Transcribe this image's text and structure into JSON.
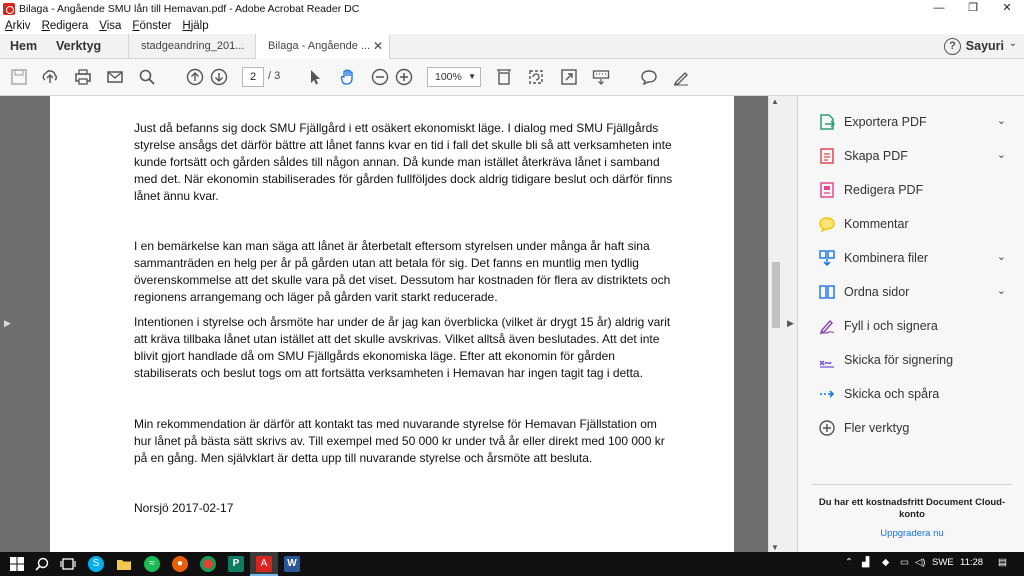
{
  "window": {
    "title": "Bilaga - Angående SMU lån till Hemavan.pdf - Adobe Acrobat Reader DC",
    "minimize": "—",
    "maximize": "❐",
    "close": "✕"
  },
  "menu": [
    {
      "accel": "A",
      "rest": "rkiv"
    },
    {
      "accel": "R",
      "rest": "edigera"
    },
    {
      "accel": "V",
      "rest": "isa"
    },
    {
      "accel": "F",
      "rest": "önster"
    },
    {
      "accel": "H",
      "rest": "jälp"
    }
  ],
  "tabs": {
    "home": "Hem",
    "tools": "Verktyg",
    "doc1": "stadgeandring_201...",
    "doc2": "Bilaga - Angående ...",
    "close": "✕"
  },
  "account": {
    "help": "?",
    "user": "Sayuri",
    "chevron": "⌄"
  },
  "toolbar": {
    "page_current": "2",
    "page_total": "/ 3",
    "zoom": "100%",
    "zoom_caret": "▼",
    "icons": [
      "save-icon",
      "upload-icon",
      "print-icon",
      "email-icon",
      "search-icon",
      "page-up-icon",
      "page-down-icon",
      "select-arrow-icon",
      "hand-icon",
      "zoom-out-icon",
      "zoom-in-icon",
      "fit-width-icon",
      "rotate-icon",
      "full-screen-icon",
      "keyboard-icon",
      "comment-icon",
      "sign-icon"
    ]
  },
  "document": {
    "paragraphs": [
      "Just då befanns sig dock SMU Fjällgård i ett osäkert ekonomiskt läge. I dialog med SMU Fjällgårds styrelse ansågs det därför bättre att lånet fanns kvar en tid i fall det skulle bli så att verksamheten inte kunde fortsätt och gården såldes till någon annan. Då kunde man istället återkräva lånet i samband med det. När ekonomin stabiliserades för gården fullföljdes dock aldrig tidigare beslut och därför finns lånet ännu kvar.",
      "I en bemärkelse kan man säga att lånet är återbetalt eftersom styrelsen under många år haft sina sammanträden en helg per år på gården utan att betala för sig. Det fanns en muntlig men tydlig överenskommelse att det skulle vara på det viset. Dessutom har kostnaden för flera av distriktets och regionens arrangemang och läger på gården varit starkt reducerade.",
      "Intentionen i styrelse och årsmöte har under de år jag kan överblicka (vilket är drygt 15 år) aldrig varit att kräva tillbaka lånet utan istället att det skulle avskrivas. Vilket alltså även beslutades. Att det inte blivit gjort handlade då om SMU Fjällgårds ekonomiska läge. Efter att ekonomin för gården stabiliserats och beslut togs om att fortsätta verksamheten i Hemavan har ingen tagit tag i detta.",
      "Min rekommendation är därför att kontakt tas med nuvarande styrelse för Hemavan Fjällstation om hur lånet på bästa sätt skrivs av. Till exempel med 50 000 kr under två år eller direkt med 100 000 kr på en gång. Men självklart är detta upp till nuvarande styrelse och årsmöte att besluta.",
      "Norsjö 2017-02-17"
    ]
  },
  "tools": [
    {
      "label": "Exportera PDF",
      "icon": "export-pdf-icon",
      "color": "#2d9d78",
      "chevron": true
    },
    {
      "label": "Skapa PDF",
      "icon": "create-pdf-icon",
      "color": "#e34850",
      "chevron": true
    },
    {
      "label": "Redigera PDF",
      "icon": "edit-pdf-icon",
      "color": "#e44a8a",
      "chevron": false
    },
    {
      "label": "Kommentar",
      "icon": "comment-icon",
      "color": "#f5c400",
      "chevron": false
    },
    {
      "label": "Kombinera filer",
      "icon": "combine-files-icon",
      "color": "#1473e6",
      "chevron": true
    },
    {
      "label": "Ordna sidor",
      "icon": "organize-pages-icon",
      "color": "#1473e6",
      "chevron": true
    },
    {
      "label": "Fyll i och signera",
      "icon": "fill-sign-icon",
      "color": "#8e44ad",
      "chevron": false
    },
    {
      "label": "Skicka för signering",
      "icon": "send-for-signature-icon",
      "color": "#6b4fd6",
      "chevron": false
    },
    {
      "label": "Skicka och spåra",
      "icon": "send-track-icon",
      "color": "#1473e6",
      "chevron": false
    },
    {
      "label": "Fler verktyg",
      "icon": "more-tools-icon",
      "color": "#555555",
      "chevron": false
    }
  ],
  "promo": {
    "text": "Du har ett kostnadsfritt Document Cloud-konto",
    "link": "Uppgradera nu"
  },
  "taskbar": {
    "language": "SWE",
    "time": "11:28"
  }
}
